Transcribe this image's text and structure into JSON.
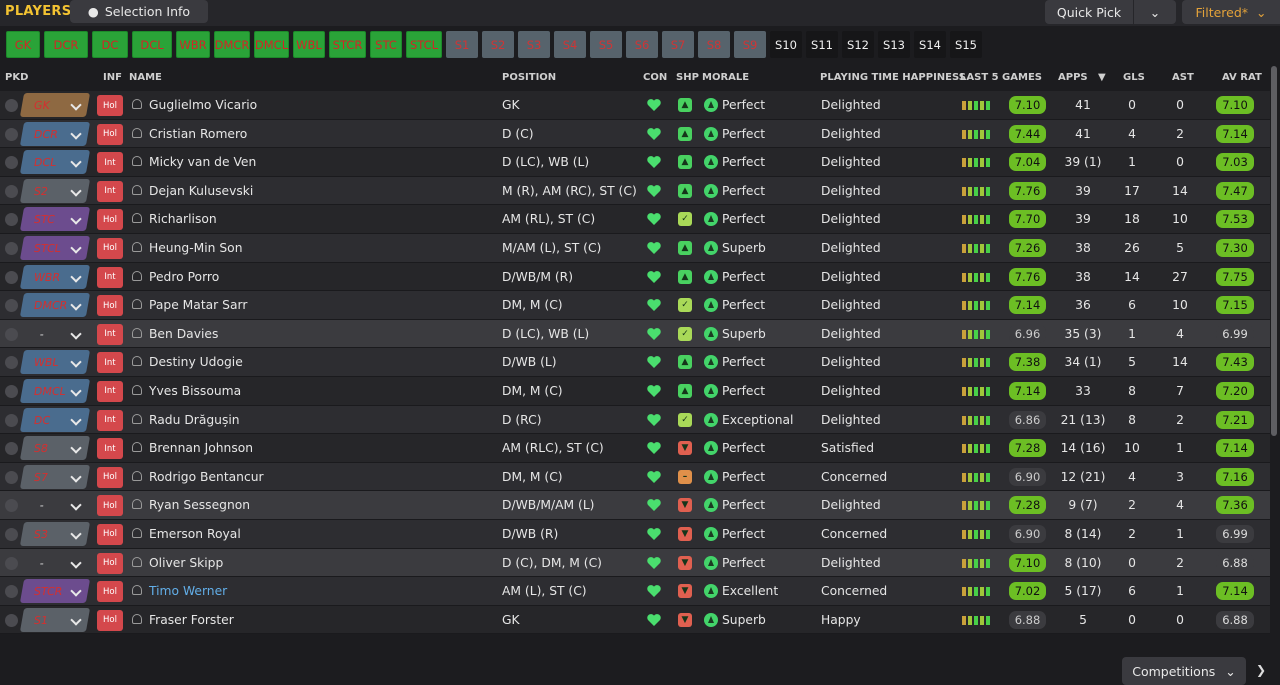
{
  "header": {
    "title": "PLAYERS",
    "selection_info": "Selection Info",
    "quick_pick": "Quick Pick",
    "filtered": "Filtered*"
  },
  "slots": [
    {
      "label": "GK",
      "kind": "g",
      "w": 34
    },
    {
      "label": "DCR",
      "kind": "g",
      "w": 44
    },
    {
      "label": "DC",
      "kind": "g",
      "w": 36
    },
    {
      "label": "DCL",
      "kind": "g",
      "w": 40
    },
    {
      "label": "WBR",
      "kind": "g",
      "w": 34
    },
    {
      "label": "DMCR",
      "kind": "g",
      "w": 36
    },
    {
      "label": "DMCL",
      "kind": "g",
      "w": 35
    },
    {
      "label": "WBL",
      "kind": "g",
      "w": 32
    },
    {
      "label": "STCR",
      "kind": "g",
      "w": 37
    },
    {
      "label": "STC",
      "kind": "g",
      "w": 32
    },
    {
      "label": "STCL",
      "kind": "g",
      "w": 36
    },
    {
      "label": "S1",
      "kind": "x",
      "w": 32
    },
    {
      "label": "S2",
      "kind": "x",
      "w": 32
    },
    {
      "label": "S3",
      "kind": "x",
      "w": 32
    },
    {
      "label": "S4",
      "kind": "x",
      "w": 32
    },
    {
      "label": "S5",
      "kind": "x",
      "w": 32
    },
    {
      "label": "S6",
      "kind": "x",
      "w": 32
    },
    {
      "label": "S7",
      "kind": "x",
      "w": 32
    },
    {
      "label": "S8",
      "kind": "x",
      "w": 32
    },
    {
      "label": "S9",
      "kind": "x",
      "w": 32
    },
    {
      "label": "S10",
      "kind": "b",
      "w": 32
    },
    {
      "label": "S11",
      "kind": "b",
      "w": 32
    },
    {
      "label": "S12",
      "kind": "b",
      "w": 32
    },
    {
      "label": "S13",
      "kind": "b",
      "w": 32
    },
    {
      "label": "S14",
      "kind": "b",
      "w": 32
    },
    {
      "label": "S15",
      "kind": "b",
      "w": 32
    }
  ],
  "columns": {
    "pkd": "PKD",
    "inf": "INF",
    "name": "NAME",
    "position": "POSITION",
    "con": "CON",
    "shp": "SHP",
    "morale": "MORALE",
    "pth": "PLAYING TIME HAPPINESS",
    "last5": "LAST 5 GAMES",
    "apps": "APPS",
    "gls": "GLS",
    "ast": "AST",
    "avrat": "AV RAT"
  },
  "players": [
    {
      "slot": "GK",
      "slot_kind": "gk",
      "inf": "Hol",
      "name": "Guglielmo Vicario",
      "position": "GK",
      "shp": "g",
      "morale": "Perfect",
      "pth": "Delighted",
      "rating": "7.10",
      "rating_kind": "gr",
      "apps": "41",
      "gls": "0",
      "ast": "0",
      "av": "7.10",
      "av_kind": "gr"
    },
    {
      "slot": "DCR",
      "slot_kind": "def",
      "inf": "Hol",
      "name": "Cristian Romero",
      "position": "D (C)",
      "shp": "g",
      "morale": "Perfect",
      "pth": "Delighted",
      "rating": "7.44",
      "rating_kind": "gr",
      "apps": "41",
      "gls": "4",
      "ast": "2",
      "av": "7.14",
      "av_kind": "gr"
    },
    {
      "slot": "DCL",
      "slot_kind": "def",
      "inf": "Int",
      "name": "Micky van de Ven",
      "position": "D (LC), WB (L)",
      "shp": "g",
      "morale": "Perfect",
      "pth": "Delighted",
      "rating": "7.04",
      "rating_kind": "gr",
      "apps": "39 (1)",
      "gls": "1",
      "ast": "0",
      "av": "7.03",
      "av_kind": "gr"
    },
    {
      "slot": "S2",
      "slot_kind": "sub",
      "inf": "Int",
      "name": "Dejan Kulusevski",
      "position": "M (R), AM (RC), ST (C)",
      "shp": "g",
      "morale": "Perfect",
      "pth": "Delighted",
      "rating": "7.76",
      "rating_kind": "gr",
      "apps": "39",
      "gls": "17",
      "ast": "14",
      "av": "7.47",
      "av_kind": "gr"
    },
    {
      "slot": "STC",
      "slot_kind": "att",
      "inf": "Hol",
      "name": "Richarlison",
      "position": "AM (RL), ST (C)",
      "shp": "y",
      "morale": "Perfect",
      "pth": "Delighted",
      "rating": "7.70",
      "rating_kind": "gr",
      "apps": "39",
      "gls": "18",
      "ast": "10",
      "av": "7.53",
      "av_kind": "gr"
    },
    {
      "slot": "STCL",
      "slot_kind": "att",
      "inf": "Hol",
      "name": "Heung-Min Son",
      "position": "M/AM (L), ST (C)",
      "shp": "g",
      "morale": "Superb",
      "pth": "Delighted",
      "rating": "7.26",
      "rating_kind": "gr",
      "apps": "38",
      "gls": "26",
      "ast": "5",
      "av": "7.30",
      "av_kind": "gr"
    },
    {
      "slot": "WBR",
      "slot_kind": "def",
      "inf": "Int",
      "name": "Pedro Porro",
      "position": "D/WB/M (R)",
      "shp": "g",
      "morale": "Perfect",
      "pth": "Delighted",
      "rating": "7.76",
      "rating_kind": "gr",
      "apps": "38",
      "gls": "14",
      "ast": "27",
      "av": "7.75",
      "av_kind": "gr"
    },
    {
      "slot": "DMCR",
      "slot_kind": "def",
      "inf": "Hol",
      "name": "Pape Matar Sarr",
      "position": "DM, M (C)",
      "shp": "y",
      "morale": "Perfect",
      "pth": "Delighted",
      "rating": "7.14",
      "rating_kind": "gr",
      "apps": "36",
      "gls": "6",
      "ast": "10",
      "av": "7.15",
      "av_kind": "gr"
    },
    {
      "slot": "-",
      "slot_kind": "none",
      "inf": "Int",
      "name": "Ben Davies",
      "position": "D (LC), WB (L)",
      "shp": "y",
      "morale": "Superb",
      "pth": "Delighted",
      "rating": "6.96",
      "rating_kind": "gy",
      "apps": "35 (3)",
      "gls": "1",
      "ast": "4",
      "av": "6.99",
      "av_kind": "gy",
      "hl": true
    },
    {
      "slot": "WBL",
      "slot_kind": "def",
      "inf": "Int",
      "name": "Destiny Udogie",
      "position": "D/WB (L)",
      "shp": "g",
      "morale": "Perfect",
      "pth": "Delighted",
      "rating": "7.38",
      "rating_kind": "gr",
      "apps": "34 (1)",
      "gls": "5",
      "ast": "14",
      "av": "7.43",
      "av_kind": "gr"
    },
    {
      "slot": "DMCL",
      "slot_kind": "def",
      "inf": "Int",
      "name": "Yves Bissouma",
      "position": "DM, M (C)",
      "shp": "g",
      "morale": "Perfect",
      "pth": "Delighted",
      "rating": "7.14",
      "rating_kind": "gr",
      "apps": "33",
      "gls": "8",
      "ast": "7",
      "av": "7.20",
      "av_kind": "gr"
    },
    {
      "slot": "DC",
      "slot_kind": "def",
      "inf": "Int",
      "name": "Radu Drăgușin",
      "position": "D (RC)",
      "shp": "y",
      "morale": "Exceptional",
      "pth": "Delighted",
      "rating": "6.86",
      "rating_kind": "gy",
      "apps": "21 (13)",
      "gls": "8",
      "ast": "2",
      "av": "7.21",
      "av_kind": "gr"
    },
    {
      "slot": "S8",
      "slot_kind": "sub",
      "inf": "Int",
      "name": "Brennan Johnson",
      "position": "AM (RLC), ST (C)",
      "shp": "r",
      "morale": "Perfect",
      "pth": "Satisfied",
      "rating": "7.28",
      "rating_kind": "gr",
      "apps": "14 (16)",
      "gls": "10",
      "ast": "1",
      "av": "7.14",
      "av_kind": "gr"
    },
    {
      "slot": "S7",
      "slot_kind": "sub",
      "inf": "Hol",
      "name": "Rodrigo Bentancur",
      "position": "DM, M (C)",
      "shp": "o",
      "morale": "Perfect",
      "pth": "Concerned",
      "rating": "6.90",
      "rating_kind": "gy",
      "apps": "12 (21)",
      "gls": "4",
      "ast": "3",
      "av": "7.16",
      "av_kind": "gr"
    },
    {
      "slot": "-",
      "slot_kind": "none",
      "inf": "Hol",
      "name": "Ryan Sessegnon",
      "position": "D/WB/M/AM (L)",
      "shp": "r",
      "morale": "Perfect",
      "pth": "Delighted",
      "rating": "7.28",
      "rating_kind": "gr",
      "apps": "9 (7)",
      "gls": "2",
      "ast": "4",
      "av": "7.36",
      "av_kind": "gr",
      "hl": true
    },
    {
      "slot": "S3",
      "slot_kind": "sub",
      "inf": "Hol",
      "name": "Emerson Royal",
      "position": "D/WB (R)",
      "shp": "r",
      "morale": "Perfect",
      "pth": "Concerned",
      "rating": "6.90",
      "rating_kind": "gy",
      "apps": "8 (14)",
      "gls": "2",
      "ast": "1",
      "av": "6.99",
      "av_kind": "gy"
    },
    {
      "slot": "-",
      "slot_kind": "none",
      "inf": "Hol",
      "name": "Oliver Skipp",
      "position": "D (C), DM, M (C)",
      "shp": "r",
      "morale": "Perfect",
      "pth": "Delighted",
      "rating": "7.10",
      "rating_kind": "gr",
      "apps": "8 (10)",
      "gls": "0",
      "ast": "2",
      "av": "6.88",
      "av_kind": "gy",
      "hl": true
    },
    {
      "slot": "STCR",
      "slot_kind": "att",
      "inf": "Hol",
      "name": "Timo Werner",
      "position": "AM (L), ST (C)",
      "shp": "r",
      "morale": "Excellent",
      "pth": "Concerned",
      "rating": "7.02",
      "rating_kind": "gr",
      "apps": "5 (17)",
      "gls": "6",
      "ast": "1",
      "av": "7.14",
      "av_kind": "gr",
      "link": true
    },
    {
      "slot": "S1",
      "slot_kind": "sub",
      "inf": "Hol",
      "name": "Fraser Forster",
      "position": "GK",
      "shp": "r",
      "morale": "Superb",
      "pth": "Happy",
      "rating": "6.88",
      "rating_kind": "gy",
      "apps": "5",
      "gls": "0",
      "ast": "0",
      "av": "6.88",
      "av_kind": "gy"
    }
  ],
  "footer": {
    "competitions": "Competitions"
  },
  "colors": {
    "accent": "#f3c332",
    "green": "#6cbe24",
    "filter": "#e3a23a"
  }
}
